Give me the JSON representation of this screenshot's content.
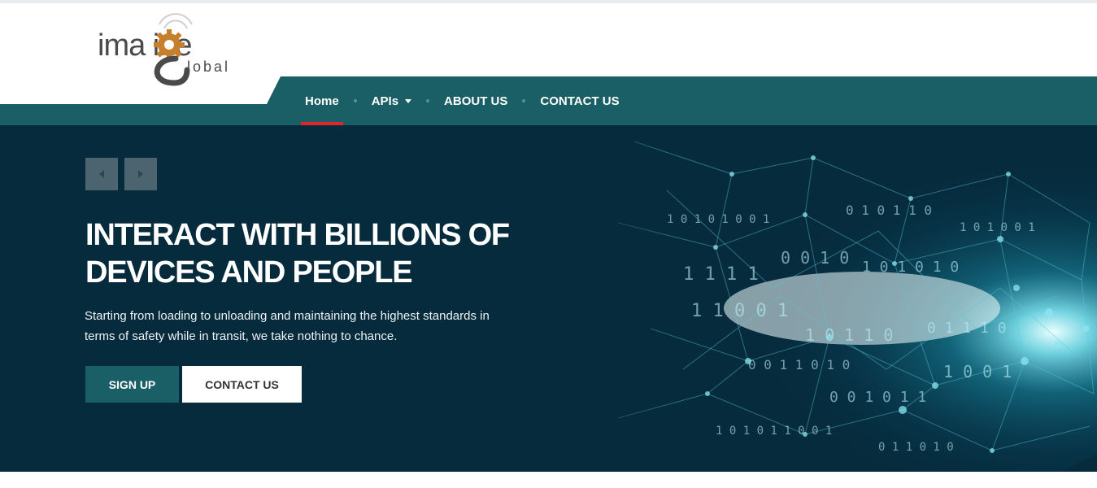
{
  "brand": {
    "logo_word": "ima ine",
    "logo_sub": "lobal"
  },
  "nav": {
    "items": [
      {
        "label": "Home",
        "active": true
      },
      {
        "label": "APIs",
        "dropdown": true
      },
      {
        "label": "ABOUT US"
      },
      {
        "label": "CONTACT US"
      }
    ]
  },
  "hero": {
    "title_line1": "INTERACT WITH BILLIONS OF",
    "title_line2": "DEVICES AND PEOPLE",
    "desc_line1": "Starting from loading to unloading and maintaining the highest standards in",
    "desc_line2": "terms of safety while in transit, we take nothing to chance.",
    "signup_label": "SIGN UP",
    "contact_label": "CONTACT US",
    "prev_icon": "triangle-left",
    "next_icon": "triangle-right"
  },
  "colors": {
    "teal": "#1b5f66",
    "navy": "#062b3d",
    "accent_red": "#e0262c",
    "gear": "#c77f2c",
    "logo_gray": "#4a4a4a"
  }
}
